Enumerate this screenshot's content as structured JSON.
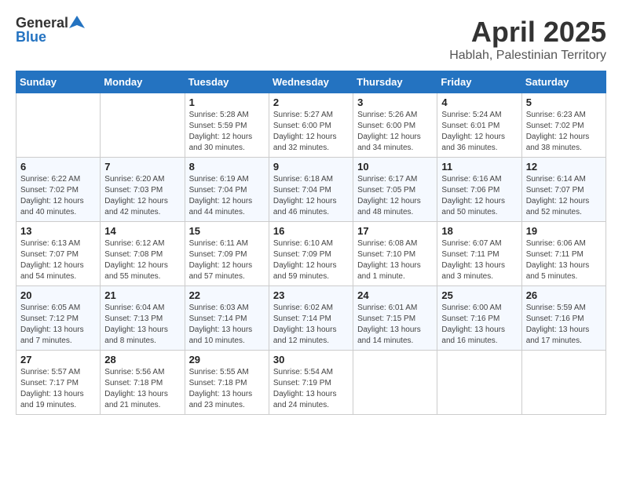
{
  "header": {
    "logo_general": "General",
    "logo_blue": "Blue",
    "title": "April 2025",
    "location": "Hablah, Palestinian Territory"
  },
  "columns": [
    "Sunday",
    "Monday",
    "Tuesday",
    "Wednesday",
    "Thursday",
    "Friday",
    "Saturday"
  ],
  "weeks": [
    [
      {
        "day": "",
        "info": ""
      },
      {
        "day": "",
        "info": ""
      },
      {
        "day": "1",
        "info": "Sunrise: 5:28 AM\nSunset: 5:59 PM\nDaylight: 12 hours\nand 30 minutes."
      },
      {
        "day": "2",
        "info": "Sunrise: 5:27 AM\nSunset: 6:00 PM\nDaylight: 12 hours\nand 32 minutes."
      },
      {
        "day": "3",
        "info": "Sunrise: 5:26 AM\nSunset: 6:00 PM\nDaylight: 12 hours\nand 34 minutes."
      },
      {
        "day": "4",
        "info": "Sunrise: 5:24 AM\nSunset: 6:01 PM\nDaylight: 12 hours\nand 36 minutes."
      },
      {
        "day": "5",
        "info": "Sunrise: 6:23 AM\nSunset: 7:02 PM\nDaylight: 12 hours\nand 38 minutes."
      }
    ],
    [
      {
        "day": "6",
        "info": "Sunrise: 6:22 AM\nSunset: 7:02 PM\nDaylight: 12 hours\nand 40 minutes."
      },
      {
        "day": "7",
        "info": "Sunrise: 6:20 AM\nSunset: 7:03 PM\nDaylight: 12 hours\nand 42 minutes."
      },
      {
        "day": "8",
        "info": "Sunrise: 6:19 AM\nSunset: 7:04 PM\nDaylight: 12 hours\nand 44 minutes."
      },
      {
        "day": "9",
        "info": "Sunrise: 6:18 AM\nSunset: 7:04 PM\nDaylight: 12 hours\nand 46 minutes."
      },
      {
        "day": "10",
        "info": "Sunrise: 6:17 AM\nSunset: 7:05 PM\nDaylight: 12 hours\nand 48 minutes."
      },
      {
        "day": "11",
        "info": "Sunrise: 6:16 AM\nSunset: 7:06 PM\nDaylight: 12 hours\nand 50 minutes."
      },
      {
        "day": "12",
        "info": "Sunrise: 6:14 AM\nSunset: 7:07 PM\nDaylight: 12 hours\nand 52 minutes."
      }
    ],
    [
      {
        "day": "13",
        "info": "Sunrise: 6:13 AM\nSunset: 7:07 PM\nDaylight: 12 hours\nand 54 minutes."
      },
      {
        "day": "14",
        "info": "Sunrise: 6:12 AM\nSunset: 7:08 PM\nDaylight: 12 hours\nand 55 minutes."
      },
      {
        "day": "15",
        "info": "Sunrise: 6:11 AM\nSunset: 7:09 PM\nDaylight: 12 hours\nand 57 minutes."
      },
      {
        "day": "16",
        "info": "Sunrise: 6:10 AM\nSunset: 7:09 PM\nDaylight: 12 hours\nand 59 minutes."
      },
      {
        "day": "17",
        "info": "Sunrise: 6:08 AM\nSunset: 7:10 PM\nDaylight: 13 hours\nand 1 minute."
      },
      {
        "day": "18",
        "info": "Sunrise: 6:07 AM\nSunset: 7:11 PM\nDaylight: 13 hours\nand 3 minutes."
      },
      {
        "day": "19",
        "info": "Sunrise: 6:06 AM\nSunset: 7:11 PM\nDaylight: 13 hours\nand 5 minutes."
      }
    ],
    [
      {
        "day": "20",
        "info": "Sunrise: 6:05 AM\nSunset: 7:12 PM\nDaylight: 13 hours\nand 7 minutes."
      },
      {
        "day": "21",
        "info": "Sunrise: 6:04 AM\nSunset: 7:13 PM\nDaylight: 13 hours\nand 8 minutes."
      },
      {
        "day": "22",
        "info": "Sunrise: 6:03 AM\nSunset: 7:14 PM\nDaylight: 13 hours\nand 10 minutes."
      },
      {
        "day": "23",
        "info": "Sunrise: 6:02 AM\nSunset: 7:14 PM\nDaylight: 13 hours\nand 12 minutes."
      },
      {
        "day": "24",
        "info": "Sunrise: 6:01 AM\nSunset: 7:15 PM\nDaylight: 13 hours\nand 14 minutes."
      },
      {
        "day": "25",
        "info": "Sunrise: 6:00 AM\nSunset: 7:16 PM\nDaylight: 13 hours\nand 16 minutes."
      },
      {
        "day": "26",
        "info": "Sunrise: 5:59 AM\nSunset: 7:16 PM\nDaylight: 13 hours\nand 17 minutes."
      }
    ],
    [
      {
        "day": "27",
        "info": "Sunrise: 5:57 AM\nSunset: 7:17 PM\nDaylight: 13 hours\nand 19 minutes."
      },
      {
        "day": "28",
        "info": "Sunrise: 5:56 AM\nSunset: 7:18 PM\nDaylight: 13 hours\nand 21 minutes."
      },
      {
        "day": "29",
        "info": "Sunrise: 5:55 AM\nSunset: 7:18 PM\nDaylight: 13 hours\nand 23 minutes."
      },
      {
        "day": "30",
        "info": "Sunrise: 5:54 AM\nSunset: 7:19 PM\nDaylight: 13 hours\nand 24 minutes."
      },
      {
        "day": "",
        "info": ""
      },
      {
        "day": "",
        "info": ""
      },
      {
        "day": "",
        "info": ""
      }
    ]
  ]
}
